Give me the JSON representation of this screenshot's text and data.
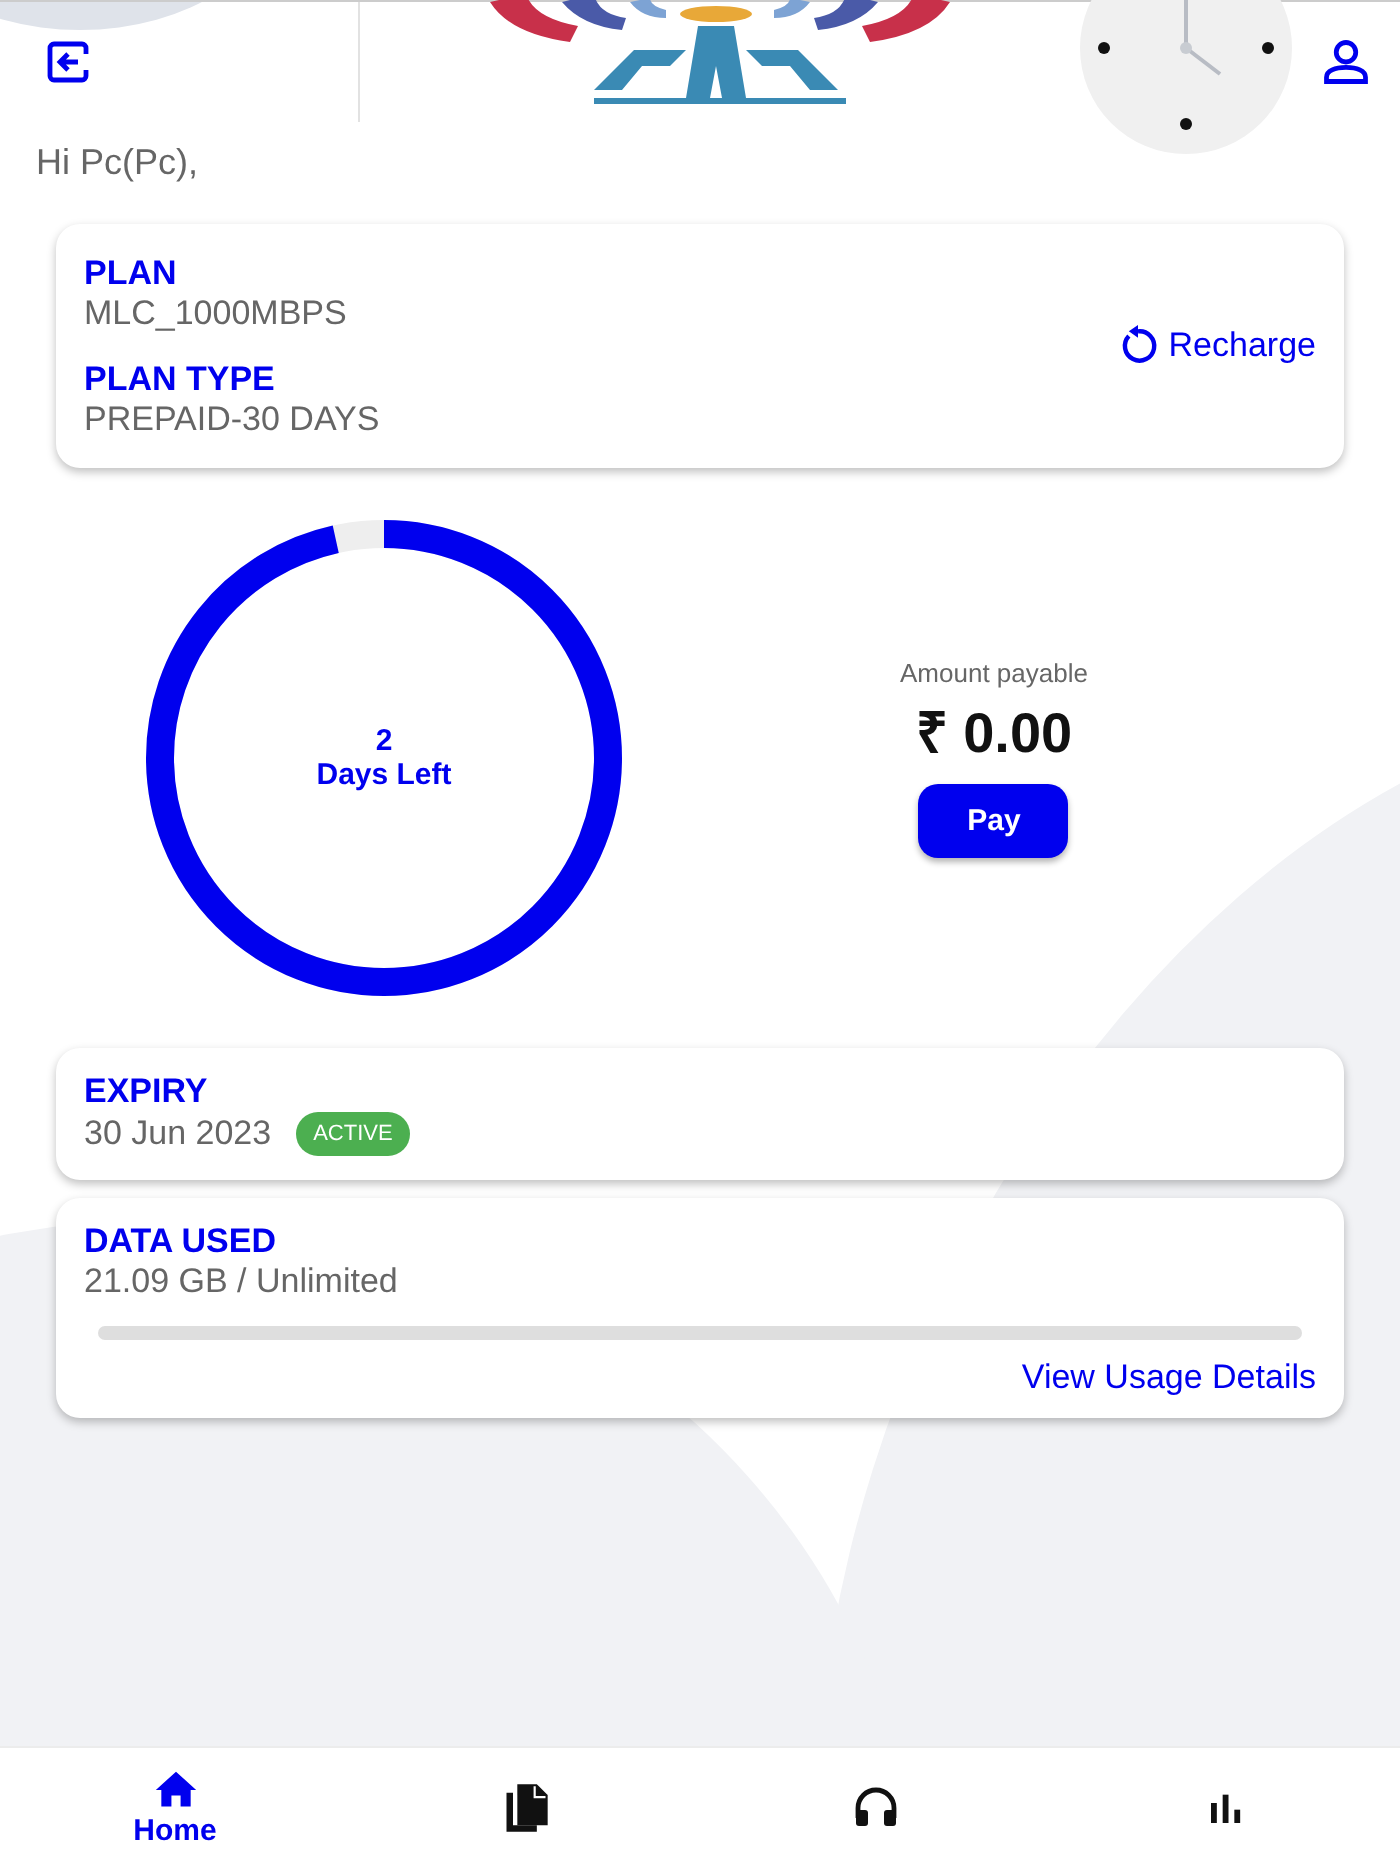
{
  "greeting": "Hi Pc(Pc),",
  "plan": {
    "plan_label": "PLAN",
    "plan_value": "MLC_1000MBPS",
    "type_label": "PLAN TYPE",
    "type_value": "PREPAID-30 DAYS",
    "recharge": "Recharge"
  },
  "days": {
    "count": "2",
    "caption": "Days Left",
    "level": 0.965
  },
  "payment": {
    "label": "Amount payable",
    "amount": "₹ 0.00",
    "button": "Pay"
  },
  "expiry": {
    "label": "EXPIRY",
    "date": "30 Jun 2023",
    "status": "ACTIVE"
  },
  "data_used": {
    "label": "DATA USED",
    "value": "21.09 GB / Unlimited",
    "level": 0,
    "link": "View Usage Details"
  },
  "nav": [
    {
      "label": "Home",
      "selected": true
    },
    {
      "selected": false
    },
    {
      "selected": false
    },
    {
      "selected": false
    }
  ]
}
